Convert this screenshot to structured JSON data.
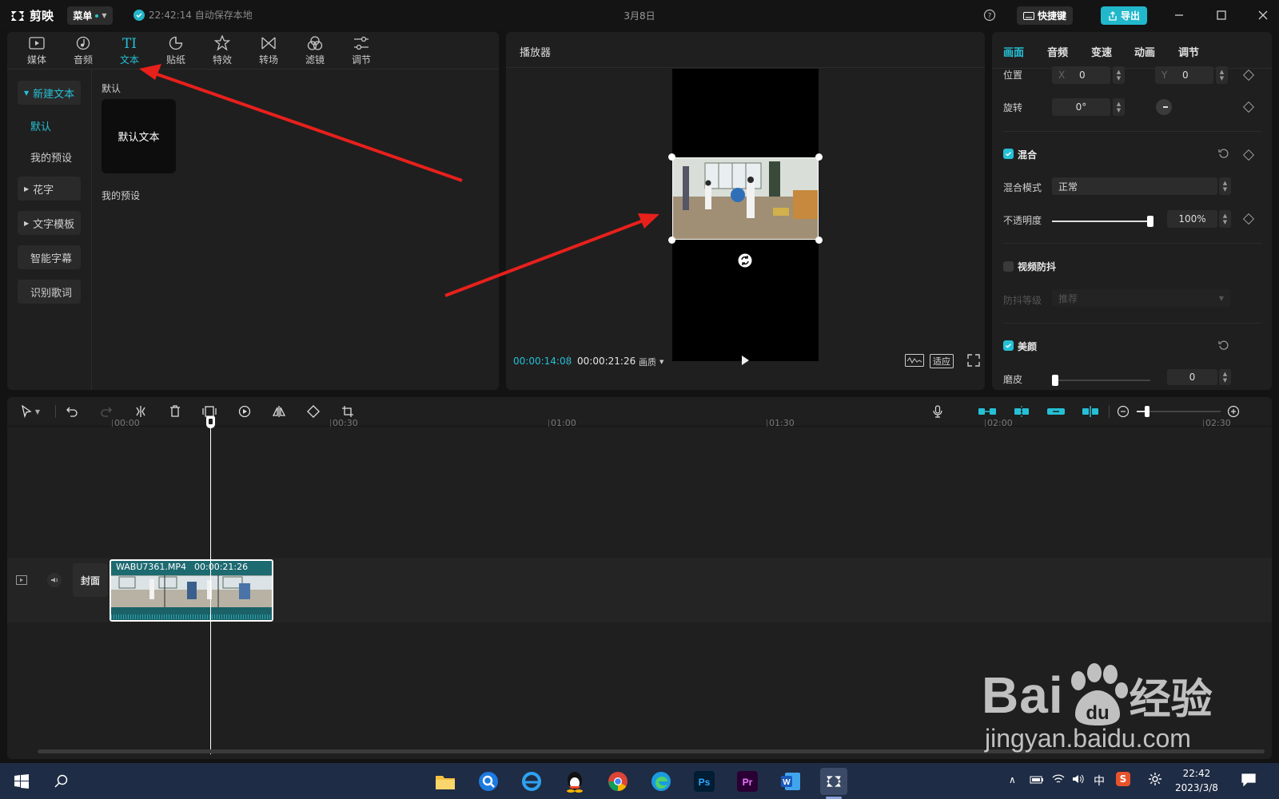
{
  "titlebar": {
    "app_name": "剪映",
    "menu_label": "菜单",
    "autosave_text": "22:42:14 自动保存本地",
    "document_title": "3月8日",
    "shortcut_label": "快捷键",
    "export_label": "导出"
  },
  "media_toolbar": {
    "items": [
      {
        "label": "媒体",
        "icon": "media-icon"
      },
      {
        "label": "音频",
        "icon": "audio-icon"
      },
      {
        "label": "文本",
        "icon": "text-icon",
        "active": true
      },
      {
        "label": "贴纸",
        "icon": "sticker-icon"
      },
      {
        "label": "特效",
        "icon": "effects-icon"
      },
      {
        "label": "转场",
        "icon": "transition-icon"
      },
      {
        "label": "滤镜",
        "icon": "filter-icon"
      },
      {
        "label": "调节",
        "icon": "adjust-icon"
      }
    ]
  },
  "text_sidebar": {
    "items": [
      "新建文本",
      "默认",
      "我的预设",
      "花字",
      "文字模板",
      "智能字幕",
      "识别歌词"
    ]
  },
  "text_content": {
    "section_default": "默认",
    "default_text_card": "默认文本",
    "section_presets": "我的预设"
  },
  "player": {
    "title": "播放器",
    "current_time": "00:00:14:08",
    "total_time": "00:00:21:26",
    "quality_label": "画质",
    "fit_label": "适应"
  },
  "inspector": {
    "tabs": [
      "画面",
      "音频",
      "变速",
      "动画",
      "调节"
    ],
    "position": {
      "label": "位置",
      "x_label": "X",
      "x_value": "0",
      "y_label": "Y",
      "y_value": "0"
    },
    "rotation": {
      "label": "旋转",
      "value": "0°"
    },
    "blend": {
      "title": "混合",
      "enabled": true,
      "mode_label": "混合模式",
      "mode_value": "正常",
      "opacity_label": "不透明度",
      "opacity_value": "100%",
      "opacity_fraction": 1.0
    },
    "stabilize": {
      "title": "视频防抖",
      "enabled": false,
      "level_label": "防抖等级",
      "level_value": "推荐"
    },
    "beauty": {
      "title": "美颜",
      "enabled": true,
      "smooth_label": "磨皮",
      "smooth_value": "0",
      "smooth_fraction": 0.0
    }
  },
  "timeline": {
    "ruler": [
      "00:00",
      "00:30",
      "01:00",
      "01:30",
      "02:00",
      "02:30"
    ],
    "cover_label": "封面",
    "clip_name": "WABU7361.MP4",
    "clip_duration": "00:00:21:26"
  },
  "taskbar": {
    "time": "22:42",
    "date": "2023/3/8",
    "ime": "中"
  },
  "watermark": {
    "brand": "Bai",
    "brand2": "经验",
    "url": "jingyan.baidu.com"
  },
  "colors": {
    "accent": "#25c0d5",
    "arrow": "#e8201c",
    "panel": "#1f1f1f",
    "background": "#131313"
  }
}
